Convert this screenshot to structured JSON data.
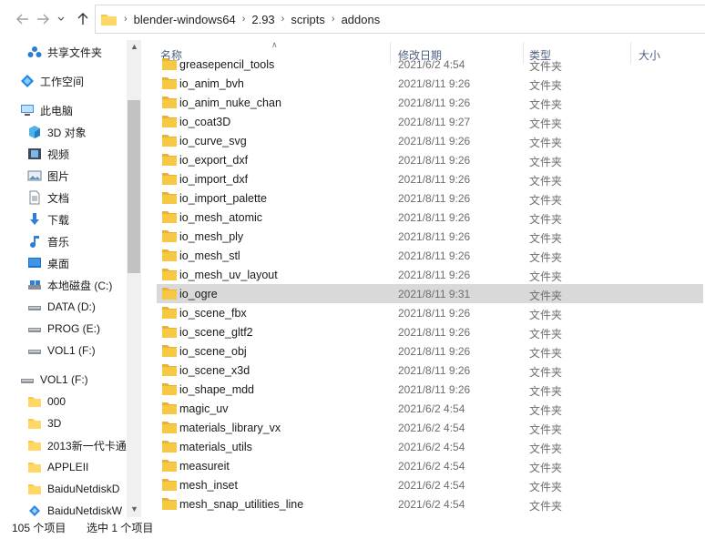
{
  "address": {
    "crumbs": [
      "blender-windows64",
      "2.93",
      "scripts",
      "addons"
    ]
  },
  "sidebar": {
    "quick": [
      {
        "label": "共享文件夹",
        "icon": "shared-folder-icon"
      },
      {
        "label": "工作空间",
        "icon": "workspace-icon"
      }
    ],
    "pc_label": "此电脑",
    "pc_items": [
      {
        "label": "3D 对象",
        "icon": "3d-objects-icon"
      },
      {
        "label": "视频",
        "icon": "video-icon"
      },
      {
        "label": "图片",
        "icon": "pictures-icon"
      },
      {
        "label": "文档",
        "icon": "documents-icon"
      },
      {
        "label": "下载",
        "icon": "downloads-icon"
      },
      {
        "label": "音乐",
        "icon": "music-icon"
      },
      {
        "label": "桌面",
        "icon": "desktop-icon"
      },
      {
        "label": "本地磁盘 (C:)",
        "icon": "local-disk-icon"
      },
      {
        "label": "DATA (D:)",
        "icon": "drive-icon"
      },
      {
        "label": "PROG (E:)",
        "icon": "drive-icon"
      },
      {
        "label": "VOL1 (F:)",
        "icon": "drive-icon"
      }
    ],
    "vol_label": "VOL1 (F:)",
    "vol_items": [
      {
        "label": "000",
        "icon": "folder-icon"
      },
      {
        "label": "3D",
        "icon": "folder-icon"
      },
      {
        "label": "2013新一代卡通",
        "icon": "folder-icon"
      },
      {
        "label": "APPLEII",
        "icon": "folder-icon"
      },
      {
        "label": "BaiduNetdiskD",
        "icon": "folder-icon"
      },
      {
        "label": "BaiduNetdiskW",
        "icon": "baidu-netdisk-icon"
      }
    ]
  },
  "columns": {
    "name": "名称",
    "date": "修改日期",
    "type": "类型",
    "size": "大小"
  },
  "files": [
    {
      "name": "greasepencil_tools",
      "date": "2021/6/2 4:54",
      "type": "文件夹"
    },
    {
      "name": "io_anim_bvh",
      "date": "2021/8/11 9:26",
      "type": "文件夹"
    },
    {
      "name": "io_anim_nuke_chan",
      "date": "2021/8/11 9:26",
      "type": "文件夹"
    },
    {
      "name": "io_coat3D",
      "date": "2021/8/11 9:27",
      "type": "文件夹"
    },
    {
      "name": "io_curve_svg",
      "date": "2021/8/11 9:26",
      "type": "文件夹"
    },
    {
      "name": "io_export_dxf",
      "date": "2021/8/11 9:26",
      "type": "文件夹"
    },
    {
      "name": "io_import_dxf",
      "date": "2021/8/11 9:26",
      "type": "文件夹"
    },
    {
      "name": "io_import_palette",
      "date": "2021/8/11 9:26",
      "type": "文件夹"
    },
    {
      "name": "io_mesh_atomic",
      "date": "2021/8/11 9:26",
      "type": "文件夹"
    },
    {
      "name": "io_mesh_ply",
      "date": "2021/8/11 9:26",
      "type": "文件夹"
    },
    {
      "name": "io_mesh_stl",
      "date": "2021/8/11 9:26",
      "type": "文件夹"
    },
    {
      "name": "io_mesh_uv_layout",
      "date": "2021/8/11 9:26",
      "type": "文件夹"
    },
    {
      "name": "io_ogre",
      "date": "2021/8/11 9:31",
      "type": "文件夹",
      "selected": true
    },
    {
      "name": "io_scene_fbx",
      "date": "2021/8/11 9:26",
      "type": "文件夹"
    },
    {
      "name": "io_scene_gltf2",
      "date": "2021/8/11 9:26",
      "type": "文件夹"
    },
    {
      "name": "io_scene_obj",
      "date": "2021/8/11 9:26",
      "type": "文件夹"
    },
    {
      "name": "io_scene_x3d",
      "date": "2021/8/11 9:26",
      "type": "文件夹"
    },
    {
      "name": "io_shape_mdd",
      "date": "2021/8/11 9:26",
      "type": "文件夹"
    },
    {
      "name": "magic_uv",
      "date": "2021/6/2 4:54",
      "type": "文件夹"
    },
    {
      "name": "materials_library_vx",
      "date": "2021/6/2 4:54",
      "type": "文件夹"
    },
    {
      "name": "materials_utils",
      "date": "2021/6/2 4:54",
      "type": "文件夹"
    },
    {
      "name": "measureit",
      "date": "2021/6/2 4:54",
      "type": "文件夹"
    },
    {
      "name": "mesh_inset",
      "date": "2021/6/2 4:54",
      "type": "文件夹"
    },
    {
      "name": "mesh_snap_utilities_line",
      "date": "2021/6/2 4:54",
      "type": "文件夹"
    }
  ],
  "status": {
    "count": "105 个项目",
    "selected": "选中 1 个项目"
  },
  "colors": {
    "folder": "#f7c843",
    "folder_dark": "#e8b23a",
    "selected_row": "#d9d9d9",
    "header_text": "#4d6082"
  }
}
